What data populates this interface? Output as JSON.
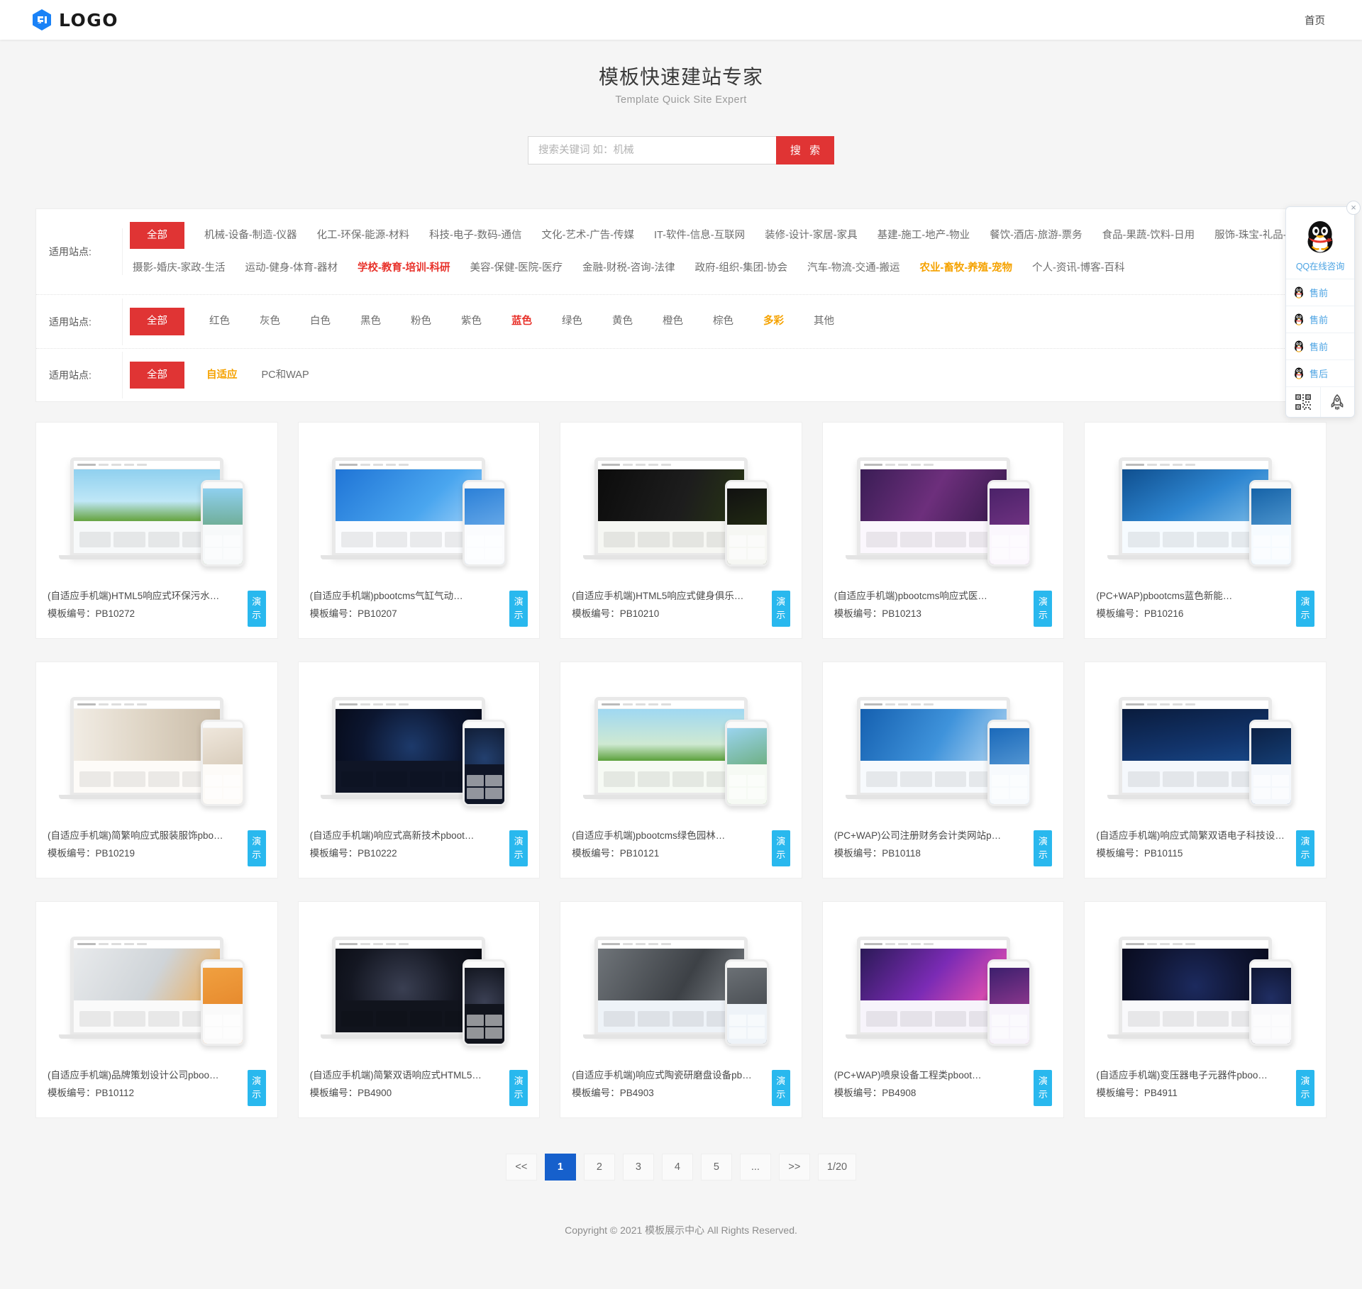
{
  "header": {
    "logo_text": "LOGO",
    "nav": [
      {
        "label": "首页"
      }
    ]
  },
  "hero": {
    "title": "模板快速建站专家",
    "subtitle": "Template Quick Site Expert"
  },
  "search": {
    "placeholder": "搜索关键词 如：机械",
    "value": "",
    "button_label": "搜 索"
  },
  "filters": [
    {
      "label": "适用站点:",
      "all_label": "全部",
      "options": [
        {
          "label": "机械-设备-制造-仪器",
          "state": "normal"
        },
        {
          "label": "化工-环保-能源-材料",
          "state": "normal"
        },
        {
          "label": "科技-电子-数码-通信",
          "state": "normal"
        },
        {
          "label": "文化-艺术-广告-传媒",
          "state": "normal"
        },
        {
          "label": "IT-软件-信息-互联网",
          "state": "normal"
        },
        {
          "label": "装修-设计-家居-家具",
          "state": "normal"
        },
        {
          "label": "基建-施工-地产-物业",
          "state": "normal"
        },
        {
          "label": "餐饮-酒店-旅游-票务",
          "state": "normal"
        },
        {
          "label": "食品-果蔬-饮料-日用",
          "state": "normal"
        },
        {
          "label": "服饰-珠宝-礼品-玩具",
          "state": "normal"
        },
        {
          "label": "摄影-婚庆-家政-生活",
          "state": "normal"
        },
        {
          "label": "运动-健身-体育-器材",
          "state": "normal"
        },
        {
          "label": "学校-教育-培训-科研",
          "state": "red"
        },
        {
          "label": "美容-保健-医院-医疗",
          "state": "normal"
        },
        {
          "label": "金融-财税-咨询-法律",
          "state": "normal"
        },
        {
          "label": "政府-组织-集团-协会",
          "state": "normal"
        },
        {
          "label": "汽车-物流-交通-搬运",
          "state": "normal"
        },
        {
          "label": "农业-畜牧-养殖-宠物",
          "state": "orange"
        },
        {
          "label": "个人-资讯-博客-百科",
          "state": "normal"
        }
      ]
    },
    {
      "label": "适用站点:",
      "all_label": "全部",
      "options": [
        {
          "label": "红色",
          "state": "normal"
        },
        {
          "label": "灰色",
          "state": "normal"
        },
        {
          "label": "白色",
          "state": "normal"
        },
        {
          "label": "黑色",
          "state": "normal"
        },
        {
          "label": "粉色",
          "state": "normal"
        },
        {
          "label": "紫色",
          "state": "normal"
        },
        {
          "label": "蓝色",
          "state": "red"
        },
        {
          "label": "绿色",
          "state": "normal"
        },
        {
          "label": "黄色",
          "state": "normal"
        },
        {
          "label": "橙色",
          "state": "normal"
        },
        {
          "label": "棕色",
          "state": "normal"
        },
        {
          "label": "多彩",
          "state": "orange"
        },
        {
          "label": "其他",
          "state": "normal"
        }
      ]
    },
    {
      "label": "适用站点:",
      "all_label": "全部",
      "options": [
        {
          "label": "自适应",
          "state": "orange"
        },
        {
          "label": "PC和WAP",
          "state": "normal"
        }
      ]
    }
  ],
  "cards": [
    {
      "title": "(自适应手机端)HTML5响应式环保污水…",
      "code_label": "模板编号：",
      "code": "PB10272",
      "demo_label": "演示",
      "theme": "nature"
    },
    {
      "title": "(自适应手机端)pbootcms气缸气动…",
      "code_label": "模板编号：",
      "code": "PB10207",
      "demo_label": "演示",
      "theme": "bluetech"
    },
    {
      "title": "(自适应手机端)HTML5响应式健身俱乐…",
      "code_label": "模板编号：",
      "code": "PB10210",
      "demo_label": "演示",
      "theme": "gym"
    },
    {
      "title": "(自适应手机端)pbootcms响应式医…",
      "code_label": "模板编号：",
      "code": "PB10213",
      "demo_label": "演示",
      "theme": "beauty"
    },
    {
      "title": "(PC+WAP)pbootcms蓝色新能…",
      "code_label": "模板编号：",
      "code": "PB10216",
      "demo_label": "演示",
      "theme": "energy"
    },
    {
      "title": "(自适应手机端)简繁响应式服装服饰pbo…",
      "code_label": "模板编号：",
      "code": "PB10219",
      "demo_label": "演示",
      "theme": "fashion"
    },
    {
      "title": "(自适应手机端)响应式高新技术pboot…",
      "code_label": "模板编号：",
      "code": "PB10222",
      "demo_label": "演示",
      "theme": "darkdots"
    },
    {
      "title": "(自适应手机端)pbootcms绿色园林…",
      "code_label": "模板编号：",
      "code": "PB10121",
      "demo_label": "演示",
      "theme": "garden"
    },
    {
      "title": "(PC+WAP)公司注册财务会计类网站p…",
      "code_label": "模板编号：",
      "code": "PB10118",
      "demo_label": "演示",
      "theme": "finance"
    },
    {
      "title": "(自适应手机端)响应式简繁双语电子科技设…",
      "code_label": "模板编号：",
      "code": "PB10115",
      "demo_label": "演示",
      "theme": "city"
    },
    {
      "title": "(自适应手机端)品牌策划设计公司pboo…",
      "code_label": "模板编号：",
      "code": "PB10112",
      "demo_label": "演示",
      "theme": "keyboard"
    },
    {
      "title": "(自适应手机端)简繁双语响应式HTML5…",
      "code_label": "模板编号：",
      "code": "PB4900",
      "demo_label": "演示",
      "theme": "coin"
    },
    {
      "title": "(自适应手机端)响应式陶瓷研磨盘设备pb…",
      "code_label": "模板编号：",
      "code": "PB4903",
      "demo_label": "演示",
      "theme": "gears"
    },
    {
      "title": "(PC+WAP)喷泉设备工程类pboot…",
      "code_label": "模板编号：",
      "code": "PB4908",
      "demo_label": "演示",
      "theme": "fountain"
    },
    {
      "title": "(自适应手机端)变压器电子元器件pboo…",
      "code_label": "模板编号：",
      "code": "PB4911",
      "demo_label": "演示",
      "theme": "globe"
    }
  ],
  "pagination": {
    "prev_label": "<<",
    "next_label": ">>",
    "ellipsis_label": "...",
    "pages": [
      "1",
      "2",
      "3",
      "4",
      "5"
    ],
    "active_page": "1",
    "counter": "1/20"
  },
  "qq": {
    "close_label": "×",
    "title": "QQ在线咨询",
    "items": [
      {
        "label": "售前"
      },
      {
        "label": "售前"
      },
      {
        "label": "售前"
      },
      {
        "label": "售后"
      }
    ]
  },
  "footer": {
    "copyright": "Copyright © 2021 模板展示中心 All Rights Reserved."
  },
  "colors": {
    "accent_red": "#e03434",
    "accent_orange": "#f5a200",
    "accent_blue": "#29b8ee",
    "page_active": "#1660cc",
    "logo_blue": "#1a82f7"
  }
}
